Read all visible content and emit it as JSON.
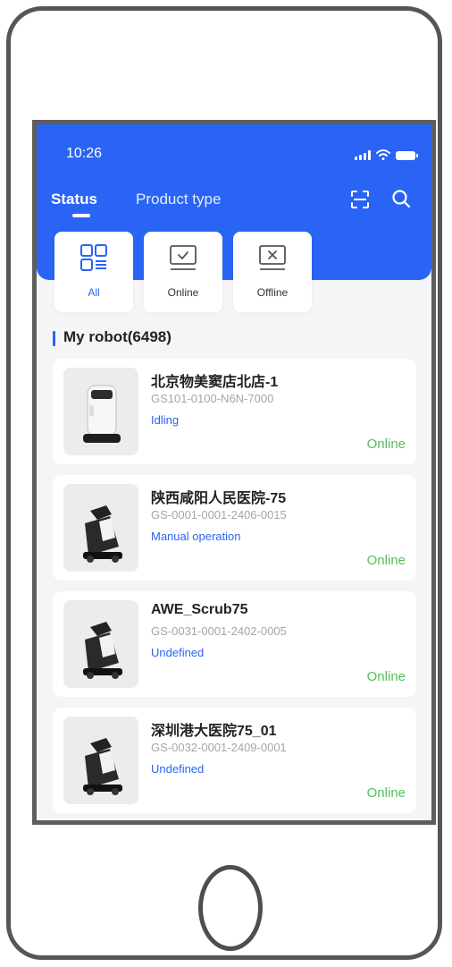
{
  "status_bar": {
    "time": "10:26"
  },
  "header": {
    "tabs": [
      {
        "label": "Status",
        "active": true
      },
      {
        "label": "Product type",
        "active": false
      }
    ],
    "icons": [
      "scan-icon",
      "search-icon"
    ]
  },
  "filters": [
    {
      "label": "All",
      "icon": "grid-list-icon",
      "active": true
    },
    {
      "label": "Online",
      "icon": "monitor-check-icon",
      "active": false
    },
    {
      "label": "Offline",
      "icon": "monitor-x-icon",
      "active": false
    }
  ],
  "section": {
    "title": "My robot(6498)"
  },
  "robots": [
    {
      "name": "北京物美窦店北店-1",
      "serial": "GS101-0100-N6N-7000",
      "state": "Idling",
      "status": "Online",
      "image": "delivery-robot"
    },
    {
      "name": "陕西咸阳人民医院-75",
      "serial": "GS-0001-0001-2406-0015",
      "state": "Manual operation",
      "status": "Online",
      "image": "scrubber-robot"
    },
    {
      "name": "AWE_Scrub75",
      "serial": "GS-0031-0001-2402-0005",
      "state": "Undefined",
      "status": "Online",
      "image": "scrubber-robot"
    },
    {
      "name": "深圳港大医院75_01",
      "serial": "GS-0032-0001-2409-0001",
      "state": "Undefined",
      "status": "Online",
      "image": "scrubber-robot"
    }
  ],
  "colors": {
    "accent": "#2a64f4",
    "online": "#52c15a",
    "background": "#f4f5f7"
  }
}
